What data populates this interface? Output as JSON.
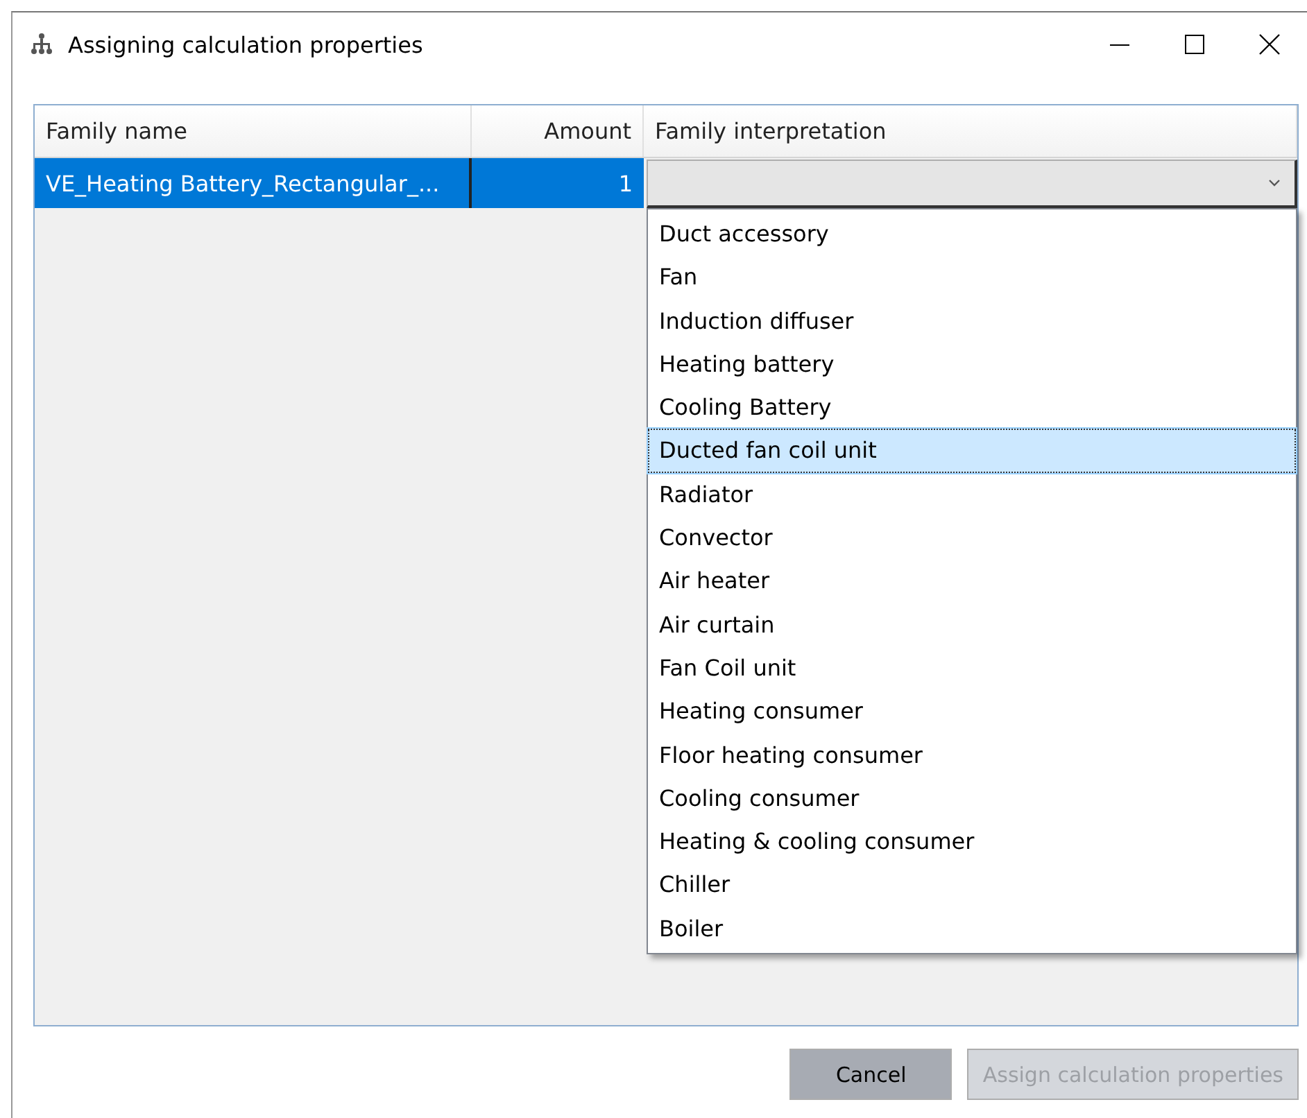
{
  "window": {
    "title": "Assigning calculation properties"
  },
  "table": {
    "columns": [
      "Family name",
      "Amount",
      "Family interpretation"
    ],
    "rows": [
      {
        "family_name": "VE_Heating Battery_Rectangular_...",
        "amount": "1",
        "family_interpretation": "",
        "selected": true
      }
    ]
  },
  "dropdown": {
    "options": [
      {
        "label": "Duct accessory",
        "selected": false
      },
      {
        "label": "Fan",
        "selected": false
      },
      {
        "label": "Induction diffuser",
        "selected": false
      },
      {
        "label": "Heating battery",
        "selected": false
      },
      {
        "label": "Cooling Battery",
        "selected": false
      },
      {
        "label": "Ducted fan coil unit",
        "selected": true
      },
      {
        "label": "Radiator",
        "selected": false
      },
      {
        "label": "Convector",
        "selected": false
      },
      {
        "label": "Air heater",
        "selected": false
      },
      {
        "label": "Air curtain",
        "selected": false
      },
      {
        "label": "Fan Coil unit",
        "selected": false
      },
      {
        "label": "Heating consumer",
        "selected": false
      },
      {
        "label": "Floor heating consumer",
        "selected": false
      },
      {
        "label": "Cooling consumer",
        "selected": false
      },
      {
        "label": "Heating & cooling consumer",
        "selected": false
      },
      {
        "label": "Chiller",
        "selected": false
      },
      {
        "label": "Boiler",
        "selected": false
      }
    ]
  },
  "buttons": [
    {
      "label": "Cancel",
      "disabled": false
    },
    {
      "label": "Assign calculation properties",
      "disabled": true
    }
  ]
}
